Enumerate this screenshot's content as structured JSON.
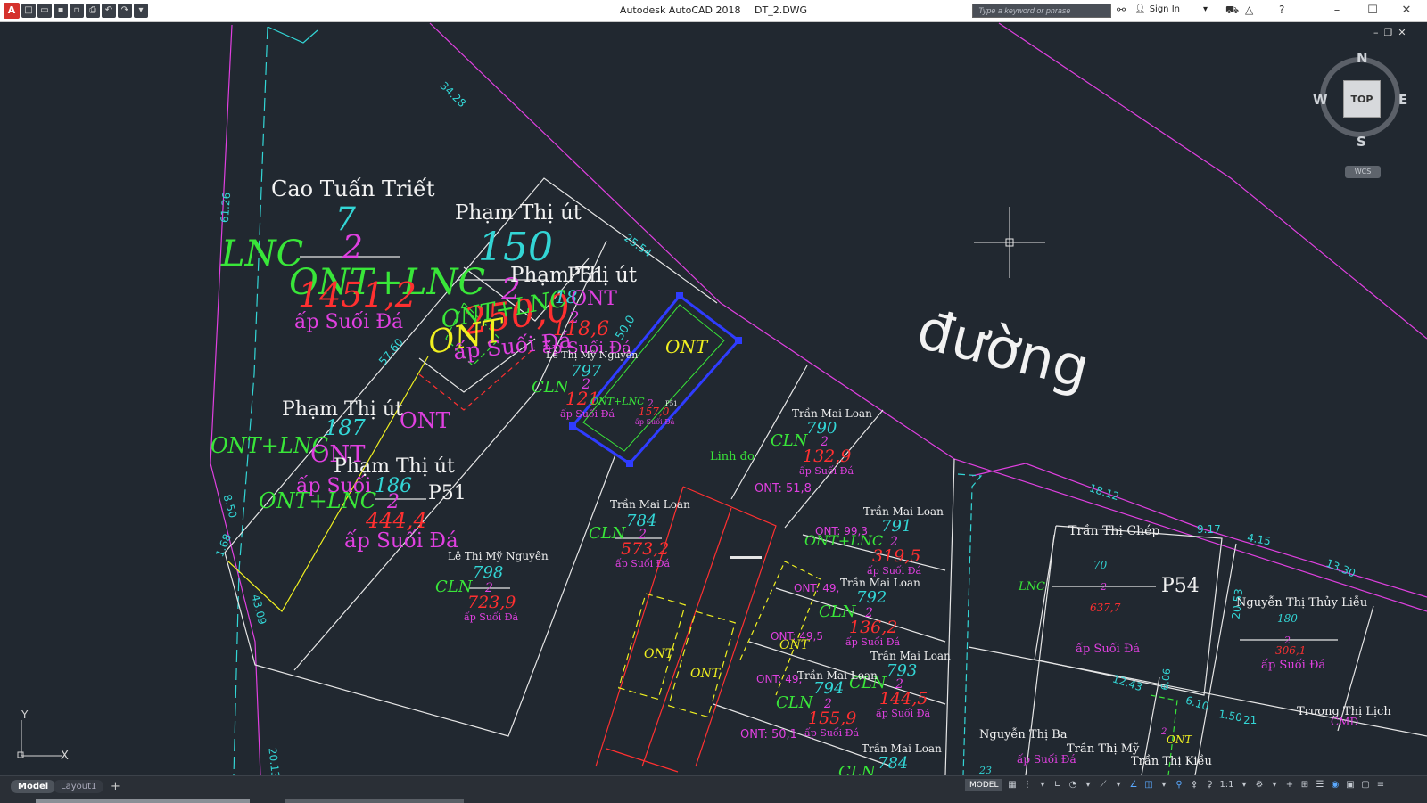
{
  "app": {
    "title": "Autodesk AutoCAD 2018",
    "file": "DT_2.DWG",
    "logo": "A"
  },
  "search": {
    "placeholder": "Type a keyword or phrase"
  },
  "account": {
    "signin": "Sign In"
  },
  "viewcube": {
    "top": "TOP",
    "north": "N",
    "south": "S",
    "east": "E",
    "west": "W",
    "wcs": "WCS"
  },
  "ucs": {
    "x": "X",
    "y": "Y"
  },
  "tabs": {
    "model": "Model",
    "layout1": "Layout1",
    "add": "+"
  },
  "status": {
    "model": "MODEL",
    "scale": "1:1"
  },
  "colors": {
    "background": "#212830",
    "magenta": "#e040e0",
    "cyan": "#33d6d6",
    "green": "#39e639",
    "red": "#ff3030",
    "yellow": "#f0f020",
    "white": "#f2f2f2",
    "selection": "#2f3cff"
  },
  "drawing": {
    "road": "đường",
    "parcels": {
      "p1": {
        "owner": "Cao Tuấn Triết",
        "number": "7",
        "sheet": "2",
        "type": "ONT+LNC",
        "area": "1451,2",
        "address": "ấp Suối Đá",
        "side_type": "LNC"
      },
      "p2": {
        "owner": "Phạm Thị út",
        "number": "150",
        "sheet": "2",
        "type": "ONT+LNC",
        "area": "250,0",
        "address": "ấp Suối Đá",
        "side_type": "ONT"
      },
      "p3": {
        "owner": "Phạm Thị út",
        "label": "P51",
        "number": "18",
        "sheet": "2",
        "type": "ONT",
        "area": "118,6",
        "address": "ấp Suối Đá"
      },
      "p4": {
        "owner": "Lê Thị Mỹ Nguyên",
        "number": "797",
        "sheet": "2",
        "type": "CLN",
        "area": "121",
        "address": "ấp Suối Đá"
      },
      "p5": {
        "type": "ONT",
        "sub_type": "ONT+LNC",
        "sheet": "2",
        "area": "157,0",
        "address": "ấp Suối Đá",
        "label": "P51"
      },
      "p6": {
        "owner": "Phạm Thị út",
        "number": "187",
        "type": "ONT+LNC",
        "side_type": "ONT",
        "address": "ấp Suối"
      },
      "p7": {
        "owner": "Phạm Thị út",
        "number": "186",
        "sheet": "2",
        "type": "ONT+LNC",
        "area": "444,4",
        "address": "ấp Suối Đá",
        "label": "P51",
        "side_type": "ONT"
      },
      "p8": {
        "owner": "Lê Thị Mỹ Nguyên",
        "number": "798",
        "sheet": "2",
        "type": "CLN",
        "area": "723,9",
        "address": "ấp Suối Đá"
      },
      "p9": {
        "owner": "Trần Mai Loan",
        "number": "790",
        "sheet": "2",
        "type": "CLN",
        "area": "132,9",
        "address": "ấp Suối Đá"
      },
      "p10": {
        "owner": "Trần Mai Loan",
        "number": "784",
        "sheet": "2",
        "type": "CLN",
        "area": "573,2",
        "address": "ấp Suối Đá"
      },
      "p11": {
        "owner": "Trần Mai Loan",
        "number": "791",
        "sheet": "2",
        "type": "ONT+LNC",
        "area": "319,5",
        "address": "ấp Suối Đá",
        "note": "ONT: 99,3"
      },
      "p12": {
        "owner": "Trần Mai Loan",
        "number": "792",
        "sheet": "2",
        "type": "CLN",
        "area": "136,2",
        "address": "ấp Suối Đá",
        "note": "ONT: 49,"
      },
      "p13": {
        "owner": "Trần Mai Loan",
        "number": "793",
        "sheet": "2",
        "type": "CLN",
        "area": "144,5",
        "address": "ấp Suối Đá",
        "note": "ONT: 49,5"
      },
      "p14": {
        "owner": "Trần Mai Loan",
        "number": "794",
        "sheet": "2",
        "type": "CLN",
        "area": "155,9",
        "address": "ấp Suối Đá",
        "note": "ONT: 49,"
      },
      "p15": {
        "owner": "Trần Mai Loan",
        "number": "784",
        "type": "CLN"
      },
      "p16": {
        "owner": "Trần Thị Chép",
        "number": "70",
        "sheet": "2",
        "type": "LNC",
        "area": "637,7",
        "address": "ấp Suối Đá",
        "label": "P54"
      },
      "p17": {
        "owner": "Nguyễn Thị Thủy Liễu",
        "number": "180",
        "sheet": "2",
        "area": "306,1",
        "address": "ấp Suối Đá"
      },
      "p18": {
        "owner": "Trương Thị Lịch",
        "type": "CMD"
      },
      "p19": {
        "owner": "Nguyễn Thị Ba",
        "number": "23",
        "address": "ấp Suối Đá"
      },
      "p20": {
        "owner": "Trần Thị Mỹ"
      },
      "p21": {
        "owner": "Trần Thị Kiều",
        "type": "ONT",
        "sheet": "2"
      }
    },
    "misc": {
      "linh_do": "Linh đo",
      "ont_518": "ONT: 51,8",
      "ont_501": "ONT: 50,1",
      "ont_a": "ONT",
      "ont_b": "ONT",
      "ont_c": "ONT"
    },
    "dims": {
      "d1": "34.28",
      "d2": "61.26",
      "d3": "25.54",
      "d4": "57.60",
      "d5": "8.50",
      "d6": "1.68",
      "d7": "43.09",
      "d8": "20.13",
      "d9": "18.12",
      "d10": "9.17",
      "d11": "4.15",
      "d12": "13.30",
      "d13": "20.53",
      "d14": "12.43",
      "d15": "6.10",
      "d16": "1.50",
      "d17": "21",
      "d18": "50,0",
      "d19": "6.06"
    }
  }
}
